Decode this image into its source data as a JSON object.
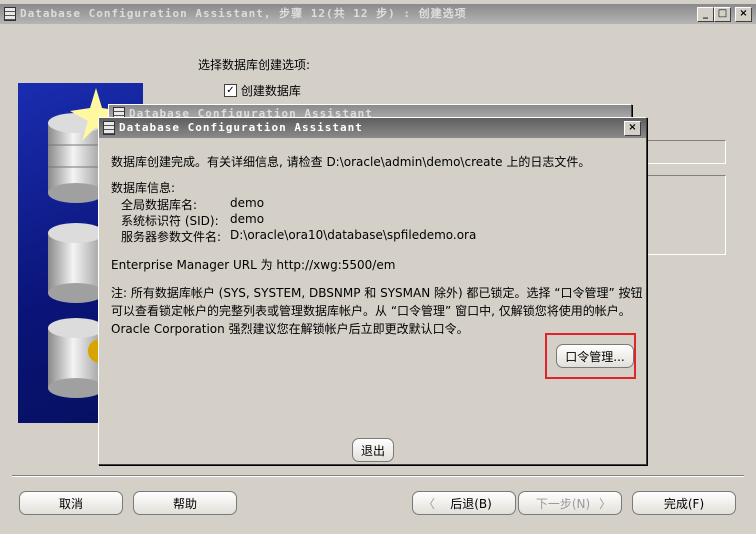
{
  "main_window": {
    "title": "Database Configuration Assistant, 步骤 12(共 12 步) : 创建选项",
    "controls": {
      "minimize": "_",
      "maximize": "□",
      "close": "×"
    },
    "section_label": "选择数据库创建选项:",
    "create_db_checkbox": {
      "label": "创建数据库",
      "checked": true
    }
  },
  "bg_dialog": {
    "title": "Database Configuration Assistant"
  },
  "dialog": {
    "title": "Database Configuration Assistant",
    "close": "×",
    "completion_message": "数据库创建完成。有关详细信息, 请检查 D:\\oracle\\admin\\demo\\create 上的日志文件。",
    "info_header": "数据库信息:",
    "info_rows": [
      {
        "label": "全局数据库名:",
        "value": "demo"
      },
      {
        "label": "系统标识符 (SID):",
        "value": "demo"
      },
      {
        "label": "服务器参数文件名:",
        "value": "D:\\oracle\\ora10\\database\\spfiledemo.ora"
      }
    ],
    "em_url": "Enterprise Manager URL 为 http://xwg:5500/em",
    "note_lines": [
      "注: 所有数据库帐户 (SYS, SYSTEM, DBSNMP 和 SYSMAN 除外) 都已锁定。选择 “口令管理” 按钮",
      "可以查看锁定帐户的完整列表或管理数据库帐户。从 “口令管理” 窗口中, 仅解锁您将使用的帐户。",
      "Oracle Corporation 强烈建议您在解锁帐户后立即更改默认口令。"
    ],
    "password_button": "口令管理...",
    "exit_button": "退出"
  },
  "footer": {
    "cancel": "取消",
    "help": "帮助",
    "back": "后退(B)",
    "next": "下一步(N)",
    "finish": "完成(F)"
  },
  "colors": {
    "highlight_border": "#e0242a",
    "side_panel": "#0c1a8c"
  }
}
